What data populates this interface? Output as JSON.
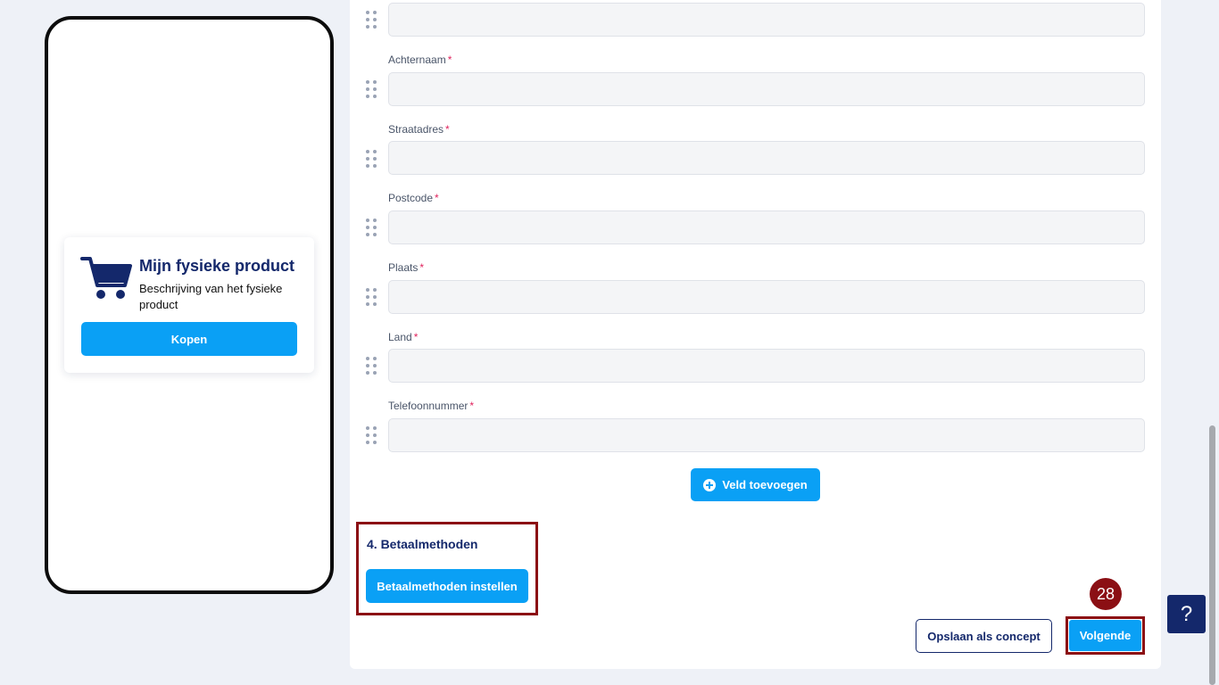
{
  "preview": {
    "product_title": "Mijn fysieke product",
    "product_description": "Beschrijving van het fysieke product",
    "buy_label": "Kopen",
    "cart_icon": "shopping-cart-icon"
  },
  "form": {
    "fields": [
      {
        "label": "",
        "required": false
      },
      {
        "label": "Achternaam",
        "required": true
      },
      {
        "label": "Straatadres",
        "required": true
      },
      {
        "label": "Postcode",
        "required": true
      },
      {
        "label": "Plaats",
        "required": true
      },
      {
        "label": "Land",
        "required": true
      },
      {
        "label": "Telefoonnummer",
        "required": true
      }
    ],
    "required_mark": "*",
    "add_field_label": "Veld toevoegen"
  },
  "payment": {
    "section_title": "4. Betaalmethoden",
    "setup_label": "Betaalmethoden instellen"
  },
  "footer": {
    "draft_label": "Opslaan als concept",
    "next_label": "Volgende",
    "step_badge": "28"
  },
  "help": {
    "label": "?"
  },
  "colors": {
    "accent": "#0aa0f5",
    "navy": "#14286b",
    "highlight": "#8b0f14",
    "required": "#e0245e"
  }
}
